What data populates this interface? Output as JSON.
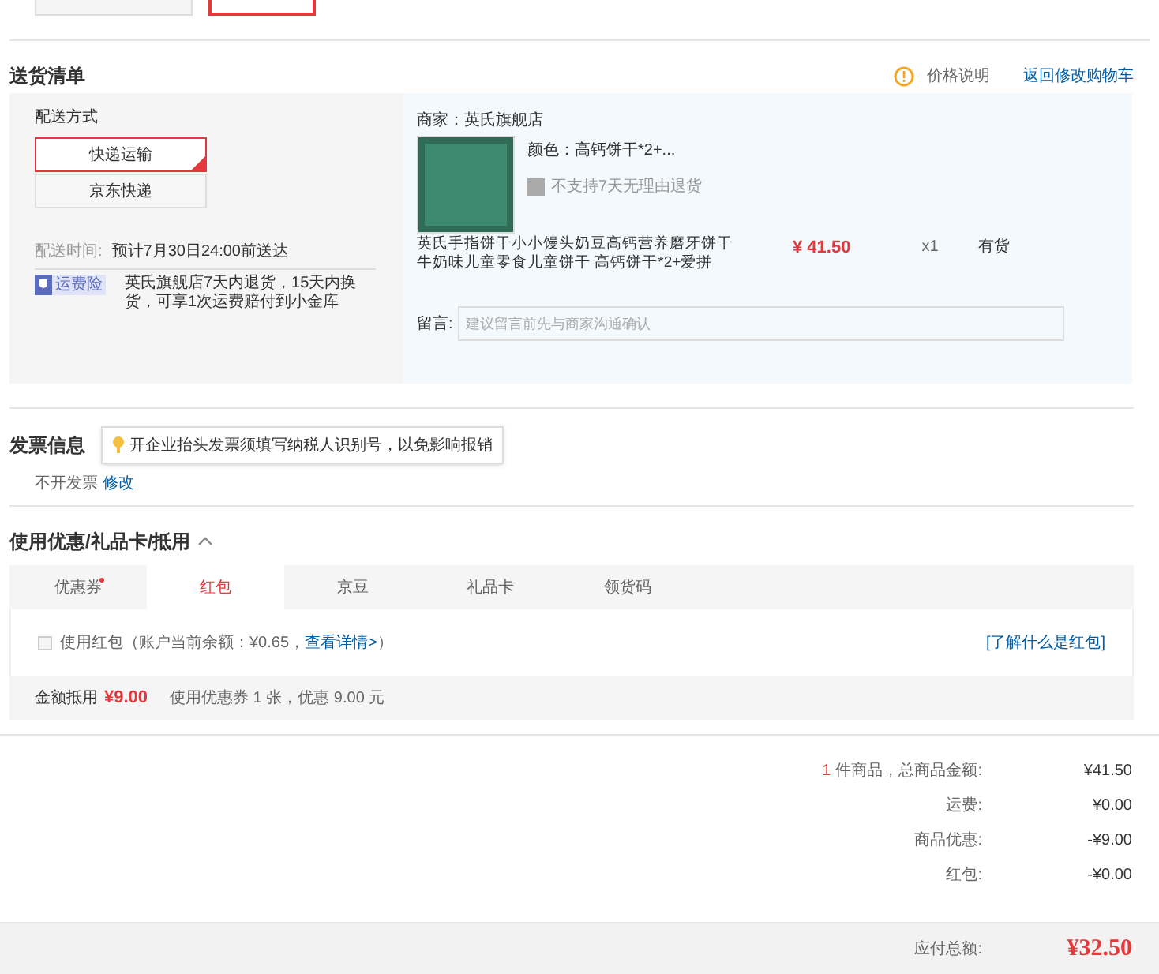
{
  "payment_options": [
    {
      "selected": false
    },
    {
      "selected": true
    }
  ],
  "shipping_list": {
    "title": "送货清单",
    "price_note": "价格说明",
    "back_link": "返回修改购物车",
    "delivery": {
      "label": "配送方式",
      "methods": [
        {
          "label": "快递运输",
          "selected": true
        },
        {
          "label": "京东快递",
          "selected": false
        }
      ],
      "time_label": "配送时间:",
      "time_value": "预计7月30日24:00前送达",
      "insurance_badge": "运费险",
      "insurance_text": "英氏旗舰店7天内退货，15天内换货，可享1次运费赔付到小金库"
    },
    "shop": {
      "merchant": "商家：英氏旗舰店",
      "variant": "颜色：高钙饼干*2+...",
      "no_return": "不支持7天无理由退货",
      "product_title": "英氏手指饼干小小馒头奶豆高钙营养磨牙饼干牛奶味儿童零食儿童饼干 高钙饼干*2+爱拼",
      "price": "¥ 41.50",
      "quantity": "x1",
      "stock": "有货",
      "message_label": "留言:",
      "message_placeholder": "建议留言前先与商家沟通确认"
    }
  },
  "invoice": {
    "title": "发票信息",
    "tip": "开企业抬头发票须填写纳税人识别号，以免影响报销",
    "status": "不开发票",
    "edit_link": "修改"
  },
  "discounts": {
    "title": "使用优惠/礼品卡/抵用",
    "expanded": true,
    "tabs": [
      {
        "label": "优惠券",
        "selected": false,
        "dot": true
      },
      {
        "label": "红包",
        "selected": true,
        "dot": false
      },
      {
        "label": "京豆",
        "selected": false,
        "dot": false
      },
      {
        "label": "礼品卡",
        "selected": false,
        "dot": false
      },
      {
        "label": "领货码",
        "selected": false,
        "dot": false
      }
    ],
    "red_packet": {
      "checked": false,
      "text_before": "使用红包（账户当前余额：¥0.65，",
      "detail_link": "查看详情>",
      "text_after": "）",
      "help_link": "[了解什么是红包]"
    },
    "footer_label": "金额抵用",
    "footer_amount": "¥9.00",
    "footer_text": "使用优惠券 1 张，优惠 9.00 元"
  },
  "summary": {
    "rows": [
      {
        "count": "1",
        "label": "件商品，总商品金额:",
        "value": "¥41.50"
      },
      {
        "label": "运费:",
        "value": "¥0.00"
      },
      {
        "label": "商品优惠:",
        "value": "-¥9.00"
      },
      {
        "label": "红包:",
        "value": "-¥0.00"
      }
    ],
    "total_label": "应付总额:",
    "total_value": "¥32.50"
  }
}
